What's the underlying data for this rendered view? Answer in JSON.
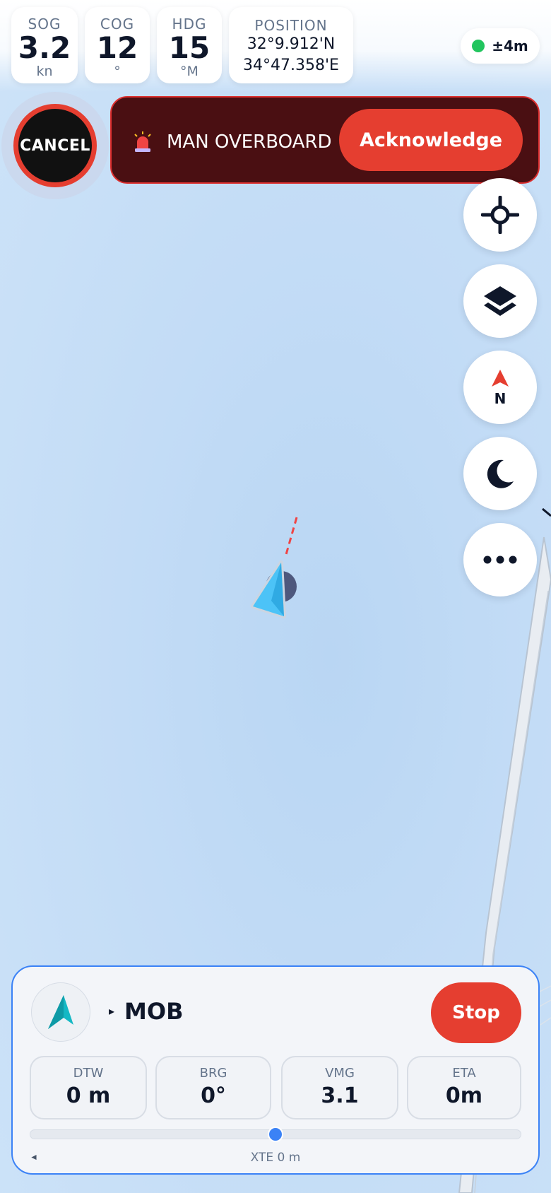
{
  "instruments": {
    "sog": {
      "label": "SOG",
      "value": "3.2",
      "unit": "kn"
    },
    "cog": {
      "label": "COG",
      "value": "12",
      "unit": "°"
    },
    "hdg": {
      "label": "HDG",
      "value": "15",
      "unit": "°M"
    },
    "position": {
      "label": "POSITION",
      "lat": "32°9.912'N",
      "lon": "34°47.358'E"
    }
  },
  "gps": {
    "accuracy": "±4m",
    "status_color": "#22c55e"
  },
  "alarm": {
    "cancel_label": "CANCEL",
    "title": "MAN OVERBOARD",
    "acknowledge_label": "Acknowledge",
    "icon": "siren-icon"
  },
  "map_controls": [
    {
      "name": "center-on-boat-button",
      "icon": "crosshair-icon"
    },
    {
      "name": "layers-button",
      "icon": "layers-icon"
    },
    {
      "name": "north-up-button",
      "icon": "north-arrow-icon",
      "label": "N"
    },
    {
      "name": "night-mode-button",
      "icon": "moon-icon"
    },
    {
      "name": "more-button",
      "icon": "ellipsis-icon"
    }
  ],
  "navigation": {
    "target_caret": "▸",
    "target_name": "MOB",
    "stop_label": "Stop",
    "metrics": [
      {
        "label": "DTW",
        "value": "0 m"
      },
      {
        "label": "BRG",
        "value": "0°"
      },
      {
        "label": "VMG",
        "value": "3.1"
      },
      {
        "label": "ETA",
        "value": "0m"
      }
    ],
    "xte_left_marker": "◄",
    "xte_label": "XTE 0 m",
    "xte_fraction": 0.5
  },
  "colors": {
    "alarm_red": "#e53e30",
    "alarm_bg": "#4a0f12",
    "accent_blue": "#3b82f6",
    "boat_cyan": "#38bdf8"
  }
}
